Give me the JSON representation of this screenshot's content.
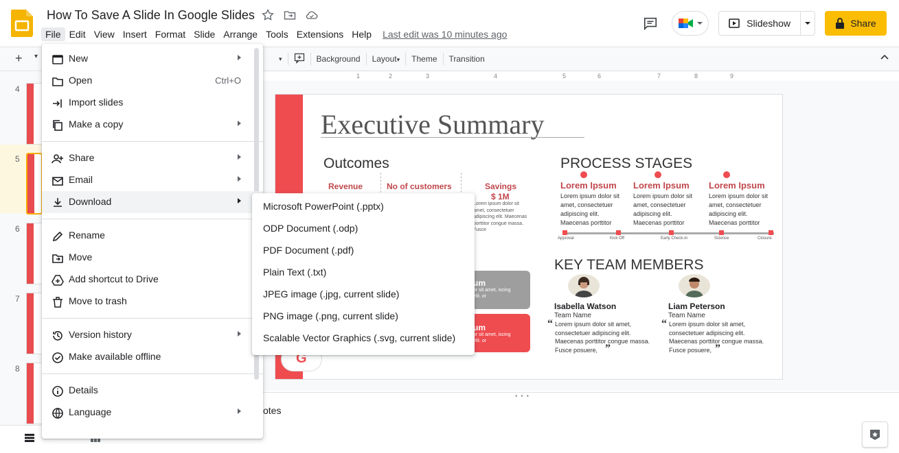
{
  "app": {
    "doc_title": "How To Save A Slide In Google Slides",
    "last_edit": "Last edit was 10 minutes ago",
    "colors": {
      "accent": "#fbbc04",
      "slide_red": "#ef4c50",
      "heading_red": "#c0474b"
    }
  },
  "menubar": [
    "File",
    "Edit",
    "View",
    "Insert",
    "Format",
    "Slide",
    "Arrange",
    "Tools",
    "Extensions",
    "Help"
  ],
  "header_right": {
    "slideshow_label": "Slideshow",
    "share_label": "Share"
  },
  "toolbar": {
    "background": "Background",
    "layout": "Layout",
    "theme": "Theme",
    "transition": "Transition"
  },
  "ruler": [
    "1",
    "2",
    "3",
    "4",
    "5",
    "6",
    "7",
    "8",
    "9"
  ],
  "slide_strip": [
    {
      "number": "4",
      "selected": false
    },
    {
      "number": "5",
      "selected": true
    },
    {
      "number": "6",
      "selected": false
    },
    {
      "number": "7",
      "selected": false
    },
    {
      "number": "8",
      "selected": false
    }
  ],
  "file_menu": {
    "items": [
      {
        "label": "New",
        "icon": "new-slides-icon",
        "submenu": true
      },
      {
        "label": "Open",
        "icon": "folder-icon",
        "shortcut": "Ctrl+O"
      },
      {
        "label": "Import slides",
        "icon": "import-icon"
      },
      {
        "label": "Make a copy",
        "icon": "copy-icon",
        "submenu": true
      },
      {
        "label": "Share",
        "icon": "person-add-icon",
        "submenu": true
      },
      {
        "label": "Email",
        "icon": "email-icon",
        "submenu": true
      },
      {
        "label": "Download",
        "icon": "download-icon",
        "submenu": true,
        "highlighted": true
      },
      {
        "label": "Rename",
        "icon": "rename-icon"
      },
      {
        "label": "Move",
        "icon": "move-folder-icon"
      },
      {
        "label": "Add shortcut to Drive",
        "icon": "drive-shortcut-icon"
      },
      {
        "label": "Move to trash",
        "icon": "trash-icon"
      },
      {
        "label": "Version history",
        "icon": "history-icon",
        "submenu": true
      },
      {
        "label": "Make available offline",
        "icon": "offline-icon"
      },
      {
        "label": "Details",
        "icon": "info-icon"
      },
      {
        "label": "Language",
        "icon": "globe-icon",
        "submenu": true
      }
    ]
  },
  "download_submenu": [
    "Microsoft PowerPoint (.pptx)",
    "ODP Document (.odp)",
    "PDF Document (.pdf)",
    "Plain Text (.txt)",
    "JPEG image (.jpg, current slide)",
    "PNG image (.png, current slide)",
    "Scalable Vector Graphics (.svg, current slide)"
  ],
  "slide": {
    "title": "Executive Summary",
    "outcomes": {
      "heading": "Outcomes",
      "columns": [
        "Revenue",
        "No of customers",
        "Savings"
      ],
      "savings_value": "$ 1M",
      "savings_text": "Lorem ipsum dolor sit amet, consectetuer adipiscing elit. Maecenas porttitor congue massa. Fusce"
    },
    "process": {
      "heading": "PROCESS STAGES",
      "steps": [
        {
          "title": "Lorem Ipsum",
          "text": "Lorem ipsum dolor sit amet, consectetuer adipiscing elit. Maecenas porttitor"
        },
        {
          "title": "Lorem Ipsum",
          "text": "Lorem ipsum dolor sit amet, consectetuer adipiscing elit. Maecenas porttitor"
        },
        {
          "title": "Lorem Ipsum",
          "text": "Lorem ipsum dolor sit amet, consectetuer adipiscing elit. Maecenas porttitor"
        }
      ],
      "timeline": [
        "Approval",
        "Kick Off",
        "Early Check-in",
        "Science",
        "Closure"
      ]
    },
    "team": {
      "heading": "KEY TEAM MEMBERS",
      "members": [
        {
          "name": "Isabella Watson",
          "role": "Team Name",
          "quote": "Lorem ipsum dolor sit amet, consectetuer adipiscing elit. Maecenas porttitor congue massa. Fusce posuere,"
        },
        {
          "name": "Liam Peterson",
          "role": "Team Name",
          "quote": "Lorem ipsum dolor sit amet, consectetuer adipiscing elit. Maecenas porttitor congue massa. Fusce posuere,"
        }
      ]
    },
    "grey_box": {
      "title": "um",
      "text": "or sit amet, iscing elit. or"
    },
    "red_box": {
      "title": "um",
      "text": "or sit amet, iscing elit. or"
    },
    "g_letter": "G"
  },
  "notes": {
    "placeholder": "otes"
  }
}
